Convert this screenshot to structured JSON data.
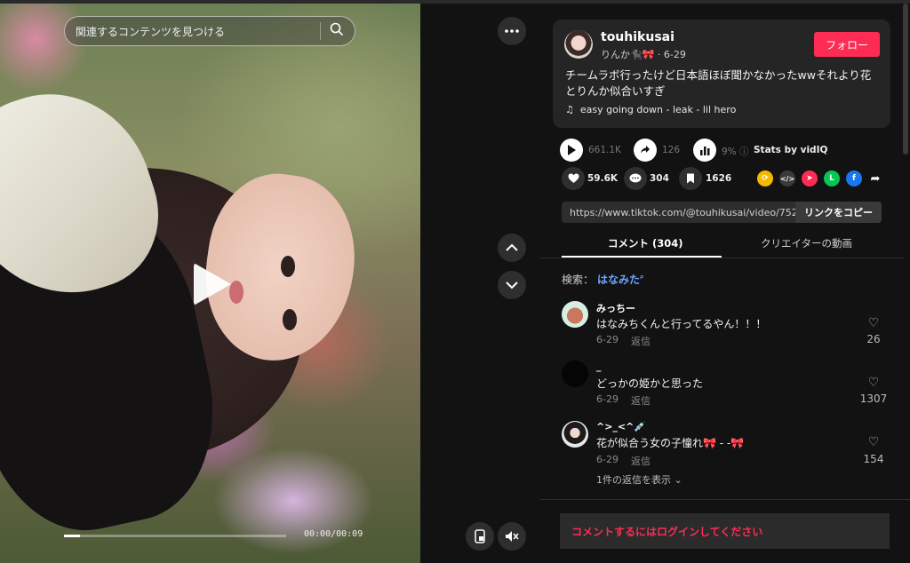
{
  "video": {
    "search_placeholder": "関連するコンテンツを見つける",
    "time": "00:00/00:09",
    "progress": 0.07
  },
  "controls": {
    "more_icon": "more-horizontal-icon",
    "up_icon": "chevron-up-icon",
    "down_icon": "chevron-down-icon",
    "pip_icon": "picture-in-picture-icon",
    "mute_icon": "speaker-muted-icon"
  },
  "post": {
    "username": "touhikusai",
    "nickname": "りんか",
    "nickname_emoji": "🐈‍⬛🎀",
    "date": "6-29",
    "follow_label": "フォロー",
    "description": "チームラボ行ったけど日本語ほぼ聞かなかったwwそれより花とりんか似合いすぎ",
    "music": "easy going down - leak - lil hero"
  },
  "stats": {
    "plays": "661.1K",
    "shares": "126",
    "rate": "9%",
    "vidiq": "Stats by vidIQ"
  },
  "actions": {
    "likes": "59.6K",
    "comments": "304",
    "saves": "1626"
  },
  "share_icons": [
    "repost-icon",
    "embed-icon",
    "send-icon",
    "line-icon",
    "facebook-icon",
    "share-arrow-icon"
  ],
  "link": {
    "url": "https://www.tiktok.com/@touhikusai/video/7521...",
    "copy_label": "リンクをコピー"
  },
  "tabs": {
    "comments": "コメント (304)",
    "creator": "クリエイターの動画"
  },
  "search": {
    "label": "検索：",
    "keyword": "はなみた"
  },
  "comments": [
    {
      "name": "みっちー",
      "text": "はなみちくんと行ってるやん！！！",
      "date": "6-29",
      "reply": "返信",
      "likes": "26"
    },
    {
      "name": "_",
      "text": "どっかの姫かと思った",
      "date": "6-29",
      "reply": "返信",
      "likes": "1307"
    },
    {
      "name": "^>_<^💉",
      "text": "花が似合う女の子憧れ🎀 - -🎀",
      "date": "6-29",
      "reply": "返信",
      "likes": "154"
    }
  ],
  "more_replies": "1件の返信を表示",
  "login_prompt": "コメントするにはログインしてください",
  "colors": {
    "accent": "#fe2c55",
    "link": "#6ea3ff",
    "bg": "#121212"
  }
}
